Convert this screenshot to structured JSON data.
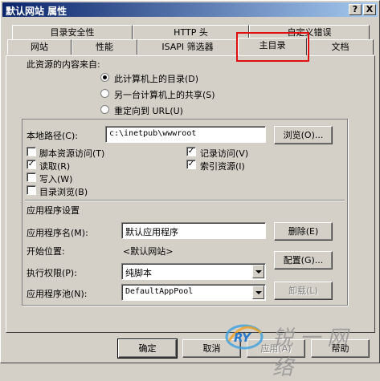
{
  "window": {
    "title": "默认网站 属性",
    "help_btn": "?",
    "close_btn": "X"
  },
  "tabs": {
    "row1": [
      "目录安全性",
      "HTTP 头",
      "自定义错误"
    ],
    "row2": [
      "网站",
      "性能",
      "ISAPI 筛选器",
      "主目录",
      "文档"
    ],
    "selected": "主目录"
  },
  "source": {
    "heading": "此资源的内容来自:",
    "options": [
      "此计算机上的目录(D)",
      "另一台计算机上的共享(S)",
      "重定向到 URL(U)"
    ],
    "selected_index": 0
  },
  "path": {
    "label": "本地路径(C):",
    "value": "c:\\inetpub\\wwwroot",
    "browse": "浏览(O)..."
  },
  "permissions": {
    "left": [
      {
        "label": "脚本资源访问(T)",
        "checked": false
      },
      {
        "label": "读取(R)",
        "checked": true
      },
      {
        "label": "写入(W)",
        "checked": false
      },
      {
        "label": "目录浏览(B)",
        "checked": false
      }
    ],
    "right": [
      {
        "label": "记录访问(V)",
        "checked": true
      },
      {
        "label": "索引资源(I)",
        "checked": true
      }
    ]
  },
  "app": {
    "heading": "应用程序设置",
    "name_label": "应用程序名(M):",
    "name_value": "默认应用程序",
    "remove": "删除(E)",
    "start_label": "开始位置:",
    "start_value": "<默认网站>",
    "config": "配置(G)...",
    "exec_label": "执行权限(P):",
    "exec_value": "纯脚本",
    "pool_label": "应用程序池(N):",
    "pool_value": "DefaultAppPool",
    "unload": "卸载(L)"
  },
  "buttons": {
    "ok": "确定",
    "cancel": "取消",
    "apply": "应用(A)",
    "help": "帮助"
  },
  "watermark": {
    "text": "锐一网络",
    "logo": "RY"
  }
}
